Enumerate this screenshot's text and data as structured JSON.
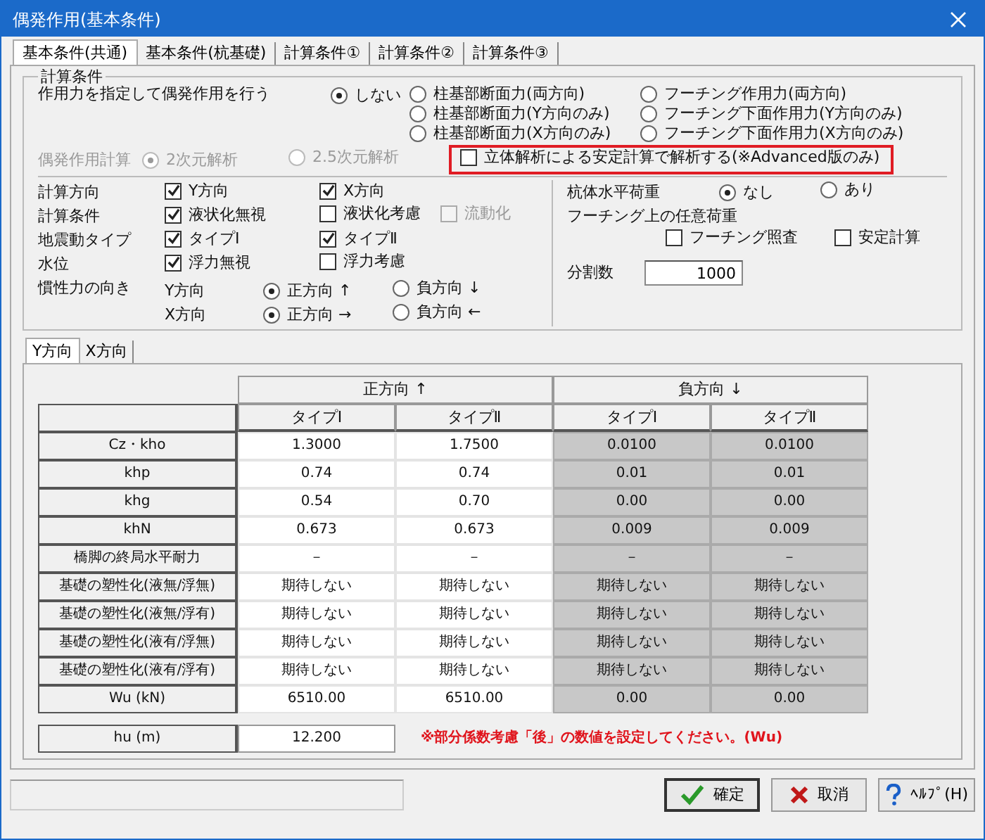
{
  "window": {
    "title": "偶発作用(基本条件)"
  },
  "tabs": [
    {
      "label": "基本条件(共通)",
      "selected": true
    },
    {
      "label": "基本条件(杭基礎)",
      "selected": false
    },
    {
      "label": "計算条件①",
      "selected": false
    },
    {
      "label": "計算条件②",
      "selected": false
    },
    {
      "label": "計算条件③",
      "selected": false
    }
  ],
  "group_title": "計算条件",
  "accidental_action": {
    "label": "作用力を指定して偶発作用を行う",
    "options": [
      {
        "label": "しない",
        "selected": true
      },
      {
        "label": "柱基部断面力(両方向)",
        "selected": false
      },
      {
        "label": "柱基部断面力(Y方向のみ)",
        "selected": false
      },
      {
        "label": "柱基部断面力(X方向のみ)",
        "selected": false
      },
      {
        "label": "フーチング作用力(両方向)",
        "selected": false
      },
      {
        "label": "フーチング下面作用力(Y方向のみ)",
        "selected": false
      },
      {
        "label": "フーチング下面作用力(X方向のみ)",
        "selected": false
      }
    ]
  },
  "analysis": {
    "label": "偶発作用計算",
    "disabled": true,
    "options": [
      {
        "label": "2次元解析",
        "selected": true
      },
      {
        "label": "2.5次元解析",
        "selected": false
      }
    ]
  },
  "solid_analysis": {
    "label": "立体解析による安定計算で解析する(※Advanced版のみ)",
    "checked": false,
    "highlighted": true
  },
  "conditions": [
    {
      "label": "計算方向",
      "items": [
        {
          "label": "Y方向",
          "checked": true,
          "disabled": false
        },
        {
          "label": "X方向",
          "checked": true,
          "disabled": false
        }
      ]
    },
    {
      "label": "計算条件",
      "items": [
        {
          "label": "液状化無視",
          "checked": true,
          "disabled": false
        },
        {
          "label": "液状化考慮",
          "checked": false,
          "disabled": false
        },
        {
          "label": "流動化",
          "checked": false,
          "disabled": true
        }
      ]
    },
    {
      "label": "地震動タイプ",
      "items": [
        {
          "label": "タイプⅠ",
          "checked": true,
          "disabled": false
        },
        {
          "label": "タイプⅡ",
          "checked": true,
          "disabled": false
        }
      ]
    },
    {
      "label": "水位",
      "items": [
        {
          "label": "浮力無視",
          "checked": true,
          "disabled": false
        },
        {
          "label": "浮力考慮",
          "checked": false,
          "disabled": false
        }
      ]
    }
  ],
  "inertia": {
    "label": "慣性力の向き",
    "rows": [
      {
        "label": "Y方向",
        "options": [
          {
            "label": "正方向 ↑",
            "selected": true
          },
          {
            "label": "負方向 ↓",
            "selected": false
          }
        ]
      },
      {
        "label": "X方向",
        "options": [
          {
            "label": "正方向 →",
            "selected": true
          },
          {
            "label": "負方向 ←",
            "selected": false
          }
        ]
      }
    ]
  },
  "pile_load": {
    "label": "杭体水平荷重",
    "options": [
      {
        "label": "なし",
        "selected": true
      },
      {
        "label": "あり",
        "selected": false
      }
    ]
  },
  "footing_load": {
    "label": "フーチング上の任意荷重",
    "items": [
      {
        "label": "フーチング照査",
        "checked": false
      },
      {
        "label": "安定計算",
        "checked": false
      }
    ]
  },
  "divisions": {
    "label": "分割数",
    "value": "1000"
  },
  "direction_tabs": [
    {
      "label": "Y方向",
      "selected": true
    },
    {
      "label": "X方向",
      "selected": false
    }
  ],
  "table": {
    "groups": [
      {
        "label": "正方向 ↑",
        "disabled": false,
        "columns": [
          "タイプⅠ",
          "タイプⅡ"
        ]
      },
      {
        "label": "負方向 ↓",
        "disabled": true,
        "columns": [
          "タイプⅠ",
          "タイプⅡ"
        ]
      }
    ],
    "rows": [
      {
        "label": "Cz・kho",
        "cells": [
          "1.3000",
          "1.7500",
          "0.0100",
          "0.0100"
        ]
      },
      {
        "label": "khp",
        "cells": [
          "0.74",
          "0.74",
          "0.01",
          "0.01"
        ]
      },
      {
        "label": "khg",
        "cells": [
          "0.54",
          "0.70",
          "0.00",
          "0.00"
        ]
      },
      {
        "label": "khN",
        "cells": [
          "0.673",
          "0.673",
          "0.009",
          "0.009"
        ]
      },
      {
        "label": "橋脚の終局水平耐力",
        "cells": [
          "－",
          "－",
          "－",
          "－"
        ]
      },
      {
        "label": "基礎の塑性化(液無/浮無)",
        "cells": [
          "期待しない",
          "期待しない",
          "期待しない",
          "期待しない"
        ]
      },
      {
        "label": "基礎の塑性化(液無/浮有)",
        "cells": [
          "期待しない",
          "期待しない",
          "期待しない",
          "期待しない"
        ]
      },
      {
        "label": "基礎の塑性化(液有/浮無)",
        "cells": [
          "期待しない",
          "期待しない",
          "期待しない",
          "期待しない"
        ]
      },
      {
        "label": "基礎の塑性化(液有/浮有)",
        "cells": [
          "期待しない",
          "期待しない",
          "期待しない",
          "期待しない"
        ]
      },
      {
        "label": "Wu (kN)",
        "cells": [
          "6510.00",
          "6510.00",
          "0.00",
          "0.00"
        ]
      }
    ]
  },
  "hu": {
    "label": "hu (m)",
    "value": "12.200",
    "note": "※部分係数考慮「後」の数値を設定してください。(Wu)"
  },
  "buttons": [
    {
      "kind": "ok",
      "label": "確定"
    },
    {
      "kind": "cancel",
      "label": "取消"
    },
    {
      "kind": "help",
      "label": "ﾍﾙﾌﾟ(H)"
    }
  ]
}
